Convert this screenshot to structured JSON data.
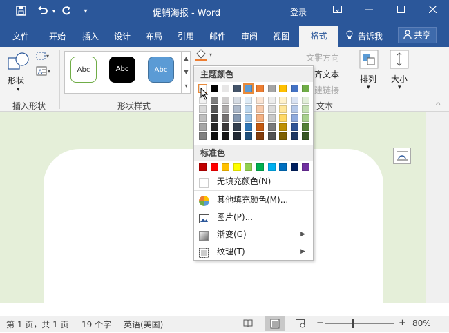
{
  "window": {
    "title": "促销海报 - Word",
    "login": "登录",
    "icons": [
      "save-icon",
      "undo-icon",
      "redo-icon",
      "customize-icon",
      "ribbon-display-icon",
      "minimize-icon",
      "maximize-icon",
      "close-icon"
    ]
  },
  "tabs": [
    {
      "label": "文件"
    },
    {
      "label": "开始"
    },
    {
      "label": "插入"
    },
    {
      "label": "设计"
    },
    {
      "label": "布局"
    },
    {
      "label": "引用"
    },
    {
      "label": "邮件"
    },
    {
      "label": "审阅"
    },
    {
      "label": "视图"
    },
    {
      "label": "格式",
      "active": true
    }
  ],
  "tell_me": "告诉我",
  "share": "共享",
  "ribbon": {
    "insert_shapes": {
      "label": "插入形状",
      "shape_btn": "形状"
    },
    "shape_styles": {
      "label": "形状样式",
      "boxes": [
        "Abc",
        "Abc",
        "Abc"
      ]
    },
    "text": {
      "direction": "文字方向",
      "align": "齐文本",
      "link": "建链接",
      "label": "文本"
    },
    "arrange": {
      "label": "排列"
    },
    "size": {
      "label": "大小"
    }
  },
  "fill_menu": {
    "theme_colors_title": "主题颜色",
    "standard_colors_title": "标准色",
    "theme_top": [
      "#ffffff",
      "#000000",
      "#e7e6e6",
      "#44546a",
      "#5b9bd5",
      "#ed7d31",
      "#a5a5a5",
      "#ffc000",
      "#4472c4",
      "#70ad47"
    ],
    "theme_shades": [
      [
        "#f2f2f2",
        "#d9d9d9",
        "#bfbfbf",
        "#a6a6a6",
        "#808080"
      ],
      [
        "#7f7f7f",
        "#595959",
        "#404040",
        "#262626",
        "#0d0d0d"
      ],
      [
        "#d0cece",
        "#aeabab",
        "#757171",
        "#3b3838",
        "#171616"
      ],
      [
        "#d6dce4",
        "#adb9ca",
        "#8497b0",
        "#333f4f",
        "#222a35"
      ],
      [
        "#deebf6",
        "#bdd7ee",
        "#9dc3e6",
        "#2e75b5",
        "#1f4e79"
      ],
      [
        "#fbe5d5",
        "#f7caac",
        "#f4b183",
        "#c55a11",
        "#833c0b"
      ],
      [
        "#ededed",
        "#dbdbdb",
        "#c9c9c9",
        "#7b7b7b",
        "#525252"
      ],
      [
        "#fff2cc",
        "#ffe699",
        "#ffd966",
        "#bf9000",
        "#7f6000"
      ],
      [
        "#dae3f3",
        "#b4c7e7",
        "#8faadc",
        "#2f5496",
        "#1f3864"
      ],
      [
        "#e2efd9",
        "#c5e0b3",
        "#a8d08d",
        "#538135",
        "#375623"
      ]
    ],
    "standard": [
      "#c00000",
      "#ff0000",
      "#ffc000",
      "#ffff00",
      "#92d050",
      "#00b050",
      "#00b0f0",
      "#0070c0",
      "#002060",
      "#7030a0"
    ],
    "items": [
      {
        "label": "无填充颜色(N)",
        "icon": "no-fill-icon"
      },
      {
        "label": "其他填充颜色(M)...",
        "icon": "color-wheel-icon"
      },
      {
        "label": "图片(P)...",
        "icon": "picture-icon"
      },
      {
        "label": "渐变(G)",
        "icon": "gradient-icon",
        "submenu": true
      },
      {
        "label": "纹理(T)",
        "icon": "texture-icon",
        "submenu": true
      }
    ]
  },
  "status": {
    "page": "第 1 页，共 1 页",
    "words": "19 个字",
    "language": "英语(美国)",
    "zoom_label": "80%",
    "zoom": 0.8
  }
}
